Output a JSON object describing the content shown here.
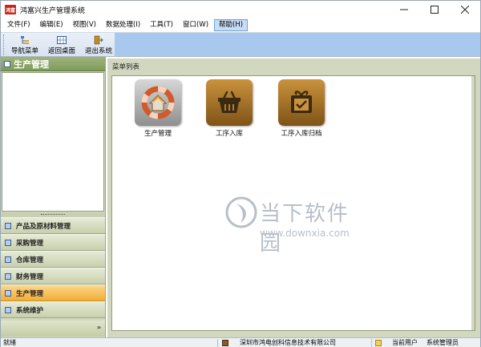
{
  "window": {
    "title": "鸿富兴生产管理系统",
    "app_icon_text": "鸿富"
  },
  "menu": {
    "items": [
      {
        "label": "文件(F)"
      },
      {
        "label": "编辑(E)"
      },
      {
        "label": "视图(V)"
      },
      {
        "label": "数据处理(I)"
      },
      {
        "label": "工具(T)"
      },
      {
        "label": "窗口(W)"
      },
      {
        "label": "帮助(H)"
      }
    ]
  },
  "toolbar": {
    "nav_menu": "导航菜单",
    "back_desktop": "返回桌面",
    "exit_system": "退出系统"
  },
  "left_panel": {
    "header": "生产管理",
    "nav_items": [
      {
        "label": "产品及原材料管理"
      },
      {
        "label": "采购管理"
      },
      {
        "label": "仓库管理"
      },
      {
        "label": "财务管理"
      },
      {
        "label": "生产管理"
      },
      {
        "label": "系统维护"
      }
    ],
    "active_item": "生产管理",
    "footer_chevron": "»"
  },
  "main_panel": {
    "header": "菜单列表",
    "tiles": [
      {
        "label": "生产管理",
        "icon": "production-house-icon"
      },
      {
        "label": "工序入库",
        "icon": "basket-icon"
      },
      {
        "label": "工序入库归档",
        "icon": "gift-box-archive-icon"
      }
    ]
  },
  "watermark": {
    "brand": "当下软件园",
    "url": "www.downxia.com"
  },
  "statusbar": {
    "status": "就绪",
    "company": "深圳市鸿电创科信息技术有限公司",
    "user_label": "当前用户",
    "user": "系统管理员"
  },
  "colors": {
    "toolbar_accent": "#a9c8ee",
    "nav_active": "#f2ad38",
    "nav_bg": "#d2d8bf",
    "left_header": "#7f9a5c"
  }
}
